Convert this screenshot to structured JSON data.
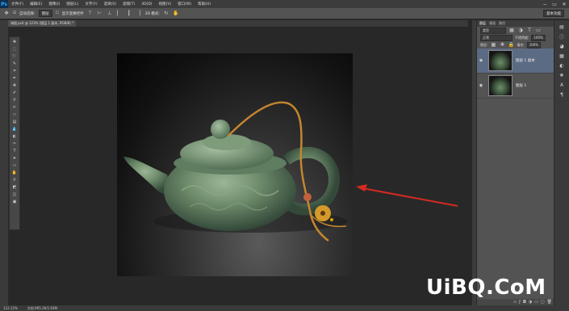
{
  "app": {
    "logo": "Ps"
  },
  "menu": {
    "items": [
      "文件(F)",
      "编辑(E)",
      "图像(I)",
      "图层(L)",
      "文字(Y)",
      "选择(S)",
      "滤镜(T)",
      "3D(D)",
      "视图(V)",
      "窗口(W)",
      "帮助(H)"
    ]
  },
  "window": {
    "minimize": "−",
    "maximize": "▭",
    "close": "✕"
  },
  "options": {
    "tool_icon": "move-tool-icon",
    "auto_select_label": "自动选择:",
    "auto_select_value": "图层",
    "show_transform_label": "显示变换控件",
    "mode_3d": "3D 模式:",
    "workspace": "基本功能"
  },
  "document": {
    "tab_label": "海报.psd @ 123% (图层 1 副本, RGB/8) *"
  },
  "status": {
    "zoom": "122.12%",
    "doc_size": "文档:965.2K/1.93M"
  },
  "layers_panel": {
    "tabs": [
      "图层",
      "通道",
      "路径"
    ],
    "filter_label": "类型",
    "blend_mode": "正常",
    "opacity_label": "不透明度:",
    "opacity_value": "100%",
    "lock_label": "锁定:",
    "fill_label": "填充:",
    "fill_value": "100%",
    "layers": [
      {
        "name": "图层 1 副本",
        "selected": true
      },
      {
        "name": "图层 1",
        "selected": false
      }
    ]
  },
  "watermark": "UiBQ.CoM",
  "colors": {
    "arrow": "#d42a22",
    "selection": "#5c6b84"
  }
}
